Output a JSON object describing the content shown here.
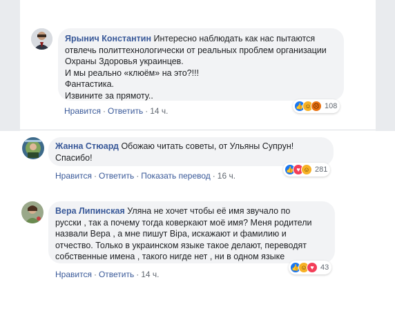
{
  "comments": [
    {
      "author": "Ярынич Константин",
      "lines": [
        "Интересно наблюдать как нас пытаются",
        "отвлечь политтехнологически от реальных проблем организации",
        "Охраны Здоровья украинцев.",
        "И мы реально «клюём» на это?!!!",
        "Фантастика.",
        "Извините за прямоту.."
      ],
      "reactions_count": "108",
      "reaction_icons": [
        "like-icon",
        "haha-icon",
        "angry-icon"
      ],
      "like_label": "Нравится",
      "reply_label": "Ответить",
      "time": "14 ч."
    },
    {
      "author": "Жанна Стюард",
      "lines": [
        "Обожаю читать советы, от Ульяны Супрун!",
        "Спасибо!"
      ],
      "reactions_count": "281",
      "reaction_icons": [
        "like-icon",
        "love-icon",
        "haha-icon"
      ],
      "like_label": "Нравится",
      "reply_label": "Ответить",
      "translate_label": "Показать перевод",
      "time": "16 ч."
    },
    {
      "author": "Вера Липинская",
      "lines": [
        "Уляна не хочет чтобы её имя звучало по",
        "русски , так а почему тогда коверкают моё имя? Меня родители",
        "назвали Вера , а мне пишут Віра, искажают и фамилию и",
        "отчество. Только в украинском языке такое делают, переводят",
        "собственные имена , такого нигде нет , ни в одном языке"
      ],
      "reactions_count": "43",
      "reaction_icons": [
        "like-icon",
        "haha-icon",
        "love-icon"
      ],
      "like_label": "Нравится",
      "reply_label": "Ответить",
      "time": "14 ч."
    }
  ],
  "colors": {
    "link": "#385898",
    "bubble": "#f2f3f5",
    "like": "#1877f2",
    "love": "#f33e58",
    "haha": "#f7b125",
    "angry": "#e9710f"
  }
}
